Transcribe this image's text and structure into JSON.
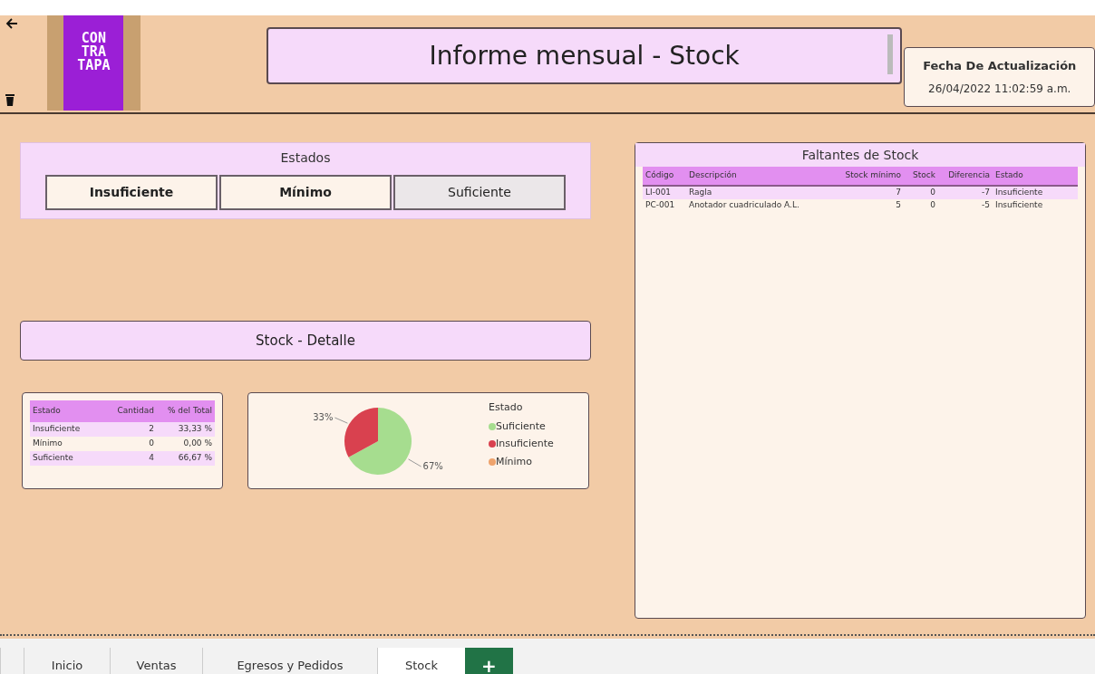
{
  "header": {
    "logo_lines": [
      "CON",
      "TRA",
      "TAPA"
    ],
    "title": "Informe mensual - Stock",
    "date_label": "Fecha De Actualización",
    "date_value": "26/04/2022 11:02:59 a.m."
  },
  "estados": {
    "title": "Estados",
    "items": [
      {
        "label": "Insuficiente",
        "selected": true
      },
      {
        "label": "Mínimo",
        "selected": true
      },
      {
        "label": "Suficiente",
        "selected": false
      }
    ]
  },
  "detalle_title": "Stock - Detalle",
  "resumen": {
    "columns": [
      "Estado",
      "Cantidad",
      "% del Total"
    ],
    "rows": [
      [
        "Insuficiente",
        "2",
        "33,33 %"
      ],
      [
        "Mínimo",
        "0",
        "0,00 %"
      ],
      [
        "Suficiente",
        "4",
        "66,67 %"
      ]
    ]
  },
  "chart_data": {
    "type": "pie",
    "categories": [
      "Suficiente",
      "Insuficiente",
      "Mínimo"
    ],
    "series": [
      {
        "name": "Estado",
        "values": [
          67,
          33,
          0
        ]
      }
    ],
    "colors": [
      "#a6dd8f",
      "#d9414f",
      "#eea36d"
    ],
    "value_labels": [
      "67%",
      "33%",
      null
    ]
  },
  "faltantes": {
    "title": "Faltantes de Stock",
    "columns": [
      "Código",
      "Descripción",
      "Stock mínimo",
      "Stock",
      "Diferencia",
      "Estado"
    ],
    "rows": [
      [
        "LI-001",
        "Ragla",
        "7",
        "0",
        "-7",
        "Insuficiente"
      ],
      [
        "PC-001",
        "Anotador cuadriculado A.L.",
        "5",
        "0",
        "-5",
        "Insuficiente"
      ]
    ]
  },
  "tabs": [
    {
      "label": "Inicio",
      "selected": false
    },
    {
      "label": "Ventas",
      "selected": false
    },
    {
      "label": "Egresos y Pedidos",
      "selected": false
    },
    {
      "label": "Stock",
      "selected": true
    }
  ],
  "add_tab": "+"
}
